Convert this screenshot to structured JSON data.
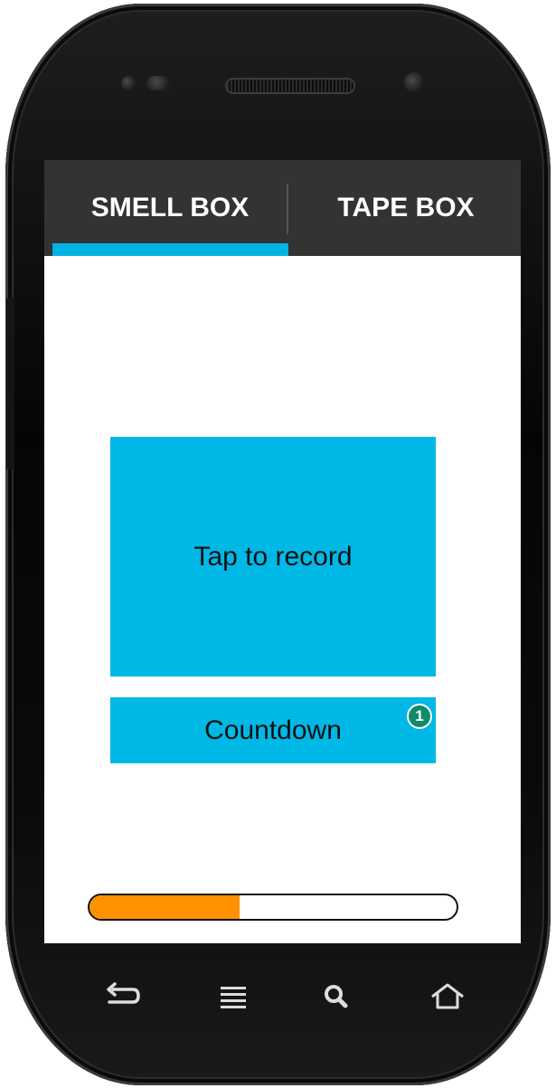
{
  "tabs": {
    "smell_box": "SMELL BOX",
    "tape_box": "TAPE BOX",
    "active": "SMELL BOX"
  },
  "main": {
    "record_label": "Tap to record",
    "countdown_label": "Countdown",
    "countdown_badge": "1"
  },
  "progress": {
    "fraction": 0.41
  },
  "navbar": {
    "icons": [
      "back-icon",
      "menu-icon",
      "search-icon",
      "home-icon"
    ]
  },
  "colors": {
    "accent": "#00b8e6",
    "tab_bar": "#333333",
    "progress": "#ff9000",
    "badge": "#118a6a"
  }
}
